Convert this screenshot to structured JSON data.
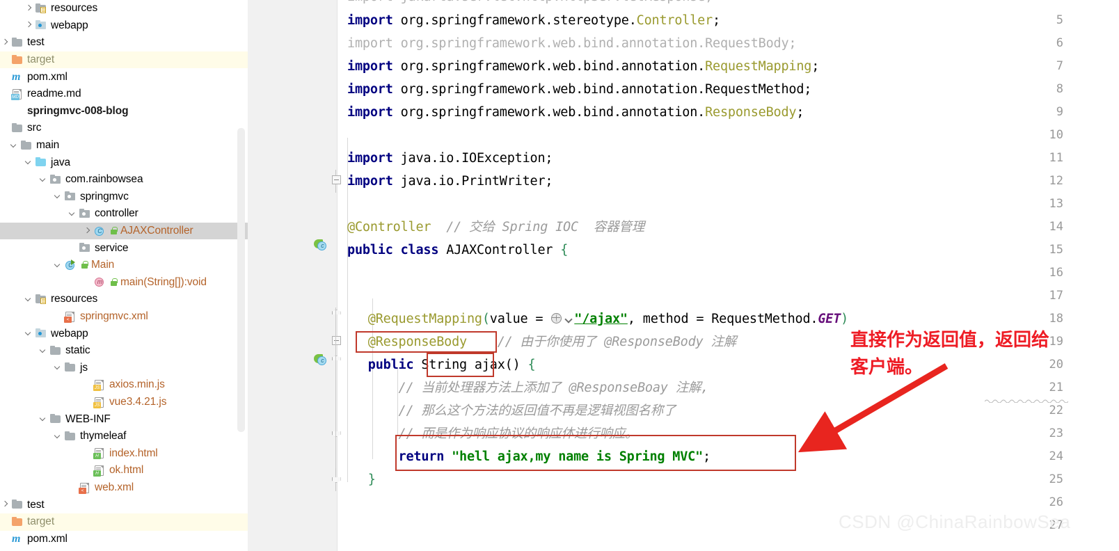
{
  "sidebar": {
    "scrollbar": "vertical-scrollbar",
    "items": [
      {
        "label": "resources",
        "indent": 2,
        "arrow": "right",
        "icon": "folder-resources-icon",
        "style": ""
      },
      {
        "label": "webapp",
        "indent": 2,
        "arrow": "right",
        "icon": "folder-webapp-icon",
        "style": ""
      },
      {
        "label": "test",
        "indent": 0,
        "arrow": "right",
        "icon": "folder-icon",
        "style": ""
      },
      {
        "label": "target",
        "indent": 0,
        "arrow": "none",
        "icon": "folder-excluded-icon",
        "style": "excluded"
      },
      {
        "label": "pom.xml",
        "indent": 0,
        "arrow": "none",
        "icon": "maven-icon",
        "style": ""
      },
      {
        "label": "readme.md",
        "indent": 0,
        "arrow": "none",
        "icon": "markdown-file-icon",
        "style": ""
      },
      {
        "label": "springmvc-008-blog",
        "indent": 0,
        "arrow": "none",
        "icon": "module-icon",
        "style": "bold"
      },
      {
        "label": "src",
        "indent": 0,
        "arrow": "none",
        "icon": "folder-icon",
        "style": ""
      },
      {
        "label": "main",
        "indent": 1,
        "arrow": "down",
        "icon": "folder-icon",
        "style": ""
      },
      {
        "label": "java",
        "indent": 2,
        "arrow": "down",
        "icon": "folder-source-icon",
        "style": ""
      },
      {
        "label": "com.rainbowsea",
        "indent": 3,
        "arrow": "down",
        "icon": "package-icon",
        "style": ""
      },
      {
        "label": "springmvc",
        "indent": 4,
        "arrow": "down",
        "icon": "package-icon",
        "style": ""
      },
      {
        "label": "controller",
        "indent": 5,
        "arrow": "down",
        "icon": "package-icon",
        "style": ""
      },
      {
        "label": "AJAXController",
        "indent": 6,
        "arrow": "right",
        "icon": "java-class-icon",
        "style": "selected-orange"
      },
      {
        "label": "service",
        "indent": 5,
        "arrow": "none",
        "icon": "package-icon",
        "style": ""
      },
      {
        "label": "Main",
        "indent": 4,
        "arrow": "down",
        "icon": "java-runnable-class-icon",
        "style": "orange"
      },
      {
        "label": "main(String[]):void",
        "indent": 6,
        "arrow": "none",
        "icon": "java-method-icon",
        "style": "orange"
      },
      {
        "label": "resources",
        "indent": 2,
        "arrow": "down",
        "icon": "folder-resources-icon",
        "style": ""
      },
      {
        "label": "springmvc.xml",
        "indent": 4,
        "arrow": "none",
        "icon": "spring-xml-file-icon",
        "style": "orange"
      },
      {
        "label": "webapp",
        "indent": 2,
        "arrow": "down",
        "icon": "folder-webapp-icon",
        "style": ""
      },
      {
        "label": "static",
        "indent": 3,
        "arrow": "down",
        "icon": "folder-icon",
        "style": ""
      },
      {
        "label": "js",
        "indent": 4,
        "arrow": "down",
        "icon": "folder-icon",
        "style": ""
      },
      {
        "label": "axios.min.js",
        "indent": 6,
        "arrow": "none",
        "icon": "javascript-file-icon",
        "style": "orange"
      },
      {
        "label": "vue3.4.21.js",
        "indent": 6,
        "arrow": "none",
        "icon": "javascript-file-icon",
        "style": "orange"
      },
      {
        "label": "WEB-INF",
        "indent": 3,
        "arrow": "down",
        "icon": "folder-icon",
        "style": ""
      },
      {
        "label": "thymeleaf",
        "indent": 4,
        "arrow": "down",
        "icon": "folder-icon",
        "style": ""
      },
      {
        "label": "index.html",
        "indent": 6,
        "arrow": "none",
        "icon": "html-file-icon",
        "style": "orange"
      },
      {
        "label": "ok.html",
        "indent": 6,
        "arrow": "none",
        "icon": "html-file-icon",
        "style": "orange"
      },
      {
        "label": "web.xml",
        "indent": 5,
        "arrow": "none",
        "icon": "xml-file-icon",
        "style": "orange"
      },
      {
        "label": "test",
        "indent": 0,
        "arrow": "right",
        "icon": "folder-icon",
        "style": ""
      },
      {
        "label": "target",
        "indent": 0,
        "arrow": "none",
        "icon": "folder-excluded-icon",
        "style": "excluded"
      },
      {
        "label": "pom.xml",
        "indent": 0,
        "arrow": "none",
        "icon": "maven-icon",
        "style": ""
      }
    ]
  },
  "editor": {
    "line_numbers": [
      "5",
      "6",
      "7",
      "8",
      "9",
      "10",
      "11",
      "12",
      "13",
      "14",
      "15",
      "16",
      "17",
      "18",
      "19",
      "20",
      "21",
      "22",
      "23",
      "24",
      "25",
      "26",
      "27"
    ],
    "partial_top_line": "import jakarta.servlet.http.HttpServletResponse;",
    "lines": {
      "l5_kw": "import",
      "l5_pkg": " org.springframework.stereotype.",
      "l5_cls": "Controller",
      "l5_semi": ";",
      "l6_full": "import org.springframework.web.bind.annotation.RequestBody;",
      "l7_kw": "import",
      "l7_pkg": " org.springframework.web.bind.annotation.",
      "l7_cls": "RequestMapping",
      "l7_semi": ";",
      "l8_kw": "import",
      "l8_pkg": " org.springframework.web.bind.annotation.RequestMethod",
      "l8_semi": ";",
      "l9_kw": "import",
      "l9_pkg": " org.springframework.web.bind.annotation.",
      "l9_cls": "ResponseBody",
      "l9_semi": ";",
      "l11_kw": "import",
      "l11_pkg": " java.io.IOException;",
      "l12_kw": "import",
      "l12_pkg": " java.io.PrintWriter;",
      "l14_ann": "@Controller",
      "l14_cm": "  // 交给 Spring IOC  容器管理",
      "l15_a": "public class ",
      "l15_cls": "AJAXController ",
      "l15_br": "{",
      "l18_ann": "    @RequestMapping",
      "l18_p1": "(",
      "l18_val": "value = ",
      "l18_str": "\"/ajax\"",
      "l18_mid": ", method = RequestMethod.",
      "l18_get": "GET",
      "l18_p2": ")",
      "l19_ann": "    @ResponseBody",
      "l19_cm": "    // 由于你使用了 @ResponseBody 注解",
      "l20_kw": "    public ",
      "l20_type": "String ",
      "l20_mth": "ajax() ",
      "l20_br": "{",
      "l21_cm": "        // 当前处理器方法上添加了 @ResponseBoay 注解,",
      "l22_cm": "        // 那么这个方法的返回值不再是逻辑视图名称了",
      "l23_cm": "        // 而是作为响应协议的响应体进行响应。",
      "l24_kw": "        return ",
      "l24_str": "\"hell ajax,my name is Spring MVC\"",
      "l24_semi": ";",
      "l25_br": "    }"
    },
    "gutter_marks": [
      {
        "line": "15",
        "icon": "spring-bean-gutter-icon"
      },
      {
        "line": "20",
        "icon": "spring-bean-gutter-icon"
      }
    ],
    "inline_icons": [
      {
        "name": "globe-icon",
        "line": "18"
      },
      {
        "name": "chevron-down-icon",
        "line": "18"
      }
    ]
  },
  "annotations": {
    "highlight_boxes": [
      {
        "name": "responsebody-highlight-box"
      },
      {
        "name": "string-return-type-highlight-box"
      },
      {
        "name": "return-statement-highlight-box"
      }
    ],
    "note_line1": "直接作为返回值，返回给",
    "note_line2": "客户端。",
    "note_color": "#ee1c25",
    "arrow": "red-arrow-pointing-to-return-statement"
  },
  "watermark": "CSDN @ChinaRainbowSea",
  "colors": {
    "selection": "#d4d4d4",
    "excluded_bg": "#fffce8",
    "keyword": "#000080",
    "string": "#008000",
    "annotation": "#9a9a2f",
    "comment": "#9b9b9b",
    "gutter_bg": "#f1f1f1",
    "annotation_red": "#c0392b"
  }
}
